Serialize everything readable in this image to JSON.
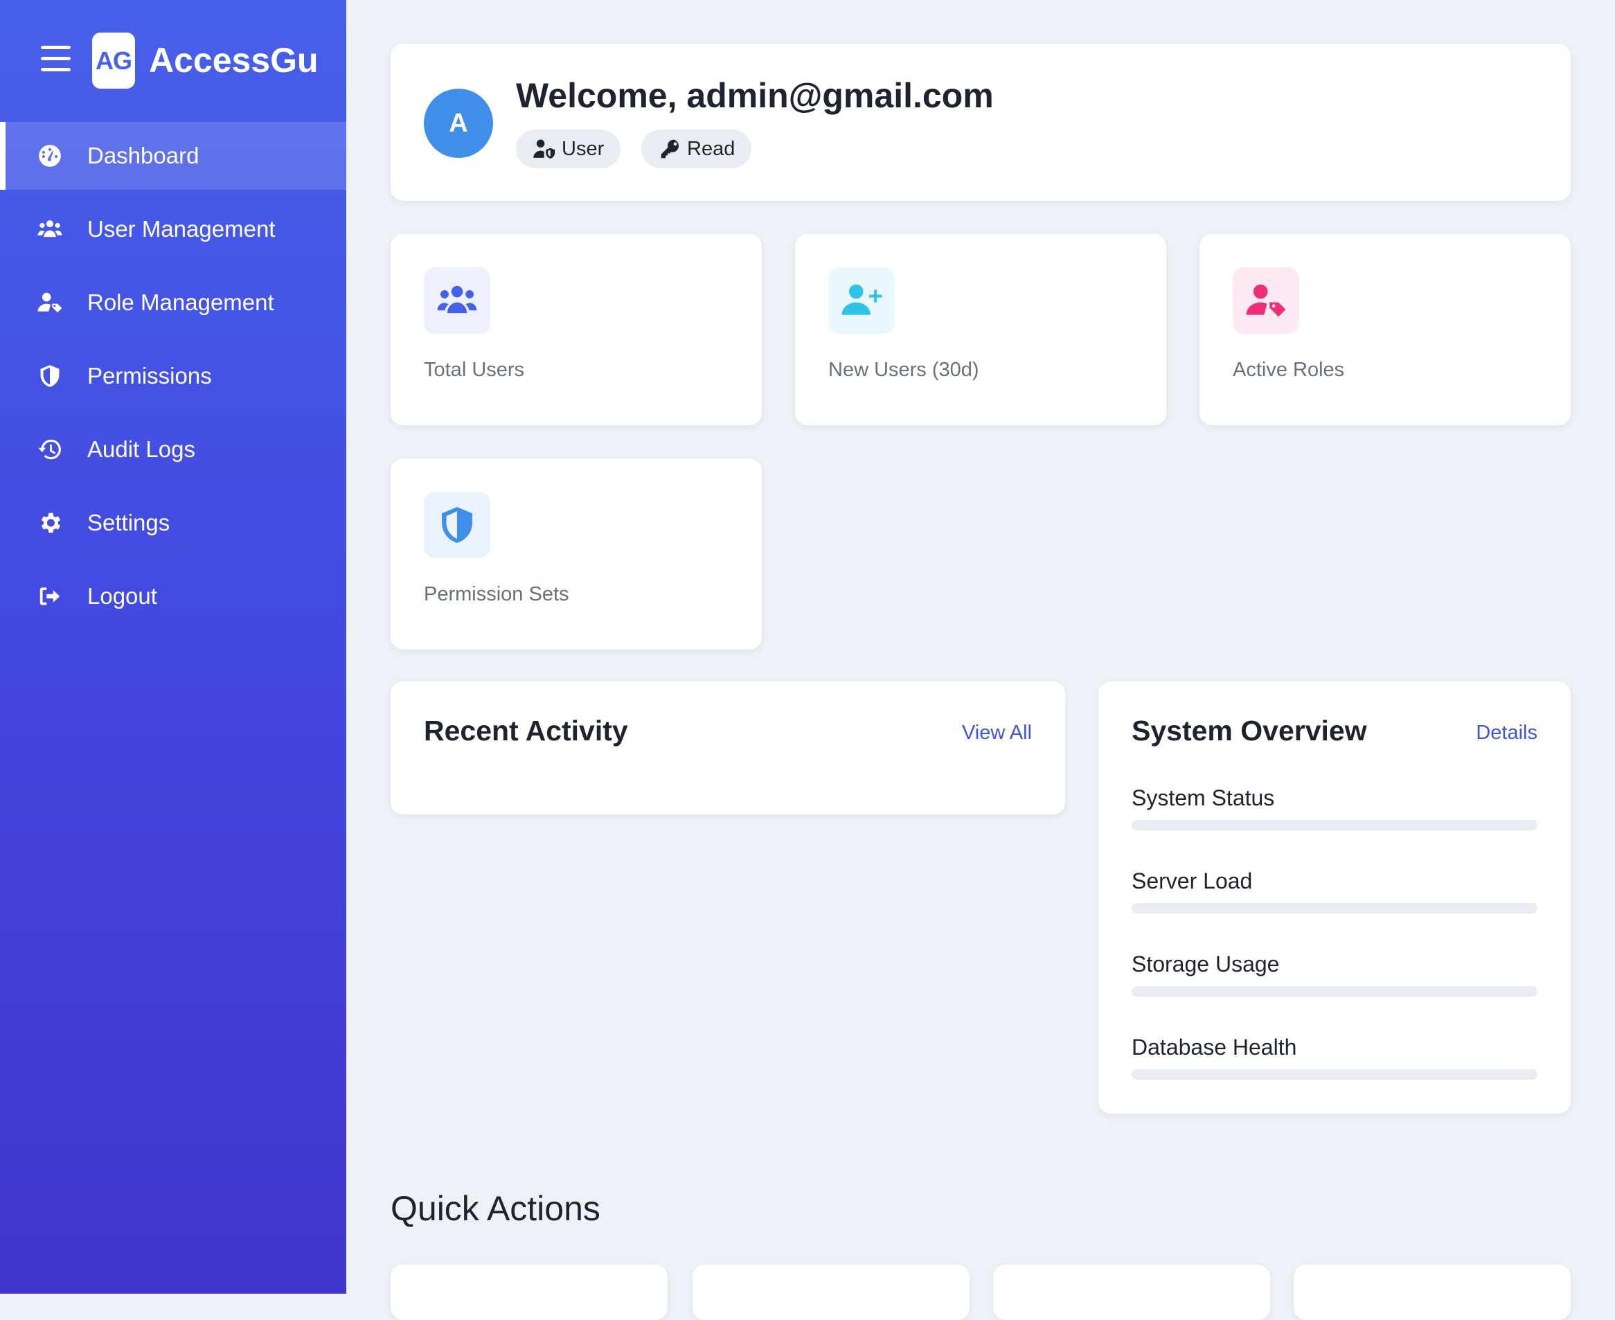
{
  "app": {
    "brand_initials": "AG",
    "brand_name": "AccessGu"
  },
  "sidebar": {
    "items": [
      {
        "label": "Dashboard",
        "icon": "dashboard-gauge-icon",
        "active": true
      },
      {
        "label": "User Management",
        "icon": "users-group-icon"
      },
      {
        "label": "Role Management",
        "icon": "user-tag-icon"
      },
      {
        "label": "Permissions",
        "icon": "shield-icon"
      },
      {
        "label": "Audit Logs",
        "icon": "history-icon"
      },
      {
        "label": "Settings",
        "icon": "gear-icon"
      },
      {
        "label": "Logout",
        "icon": "sign-out-icon"
      }
    ]
  },
  "welcome": {
    "avatar_initial": "A",
    "title": "Welcome, admin@gmail.com",
    "role_chip": "User",
    "role_chip_icon": "user-shield-icon",
    "permission_chip": "Read",
    "permission_chip_icon": "key-icon"
  },
  "stats": [
    {
      "label": "Total Users",
      "icon": "users-group-icon",
      "color": "#4660ea",
      "bg": "#eef1fd"
    },
    {
      "label": "New Users (30d)",
      "icon": "user-plus-icon",
      "color": "#2ec4ea",
      "bg": "#eaf7fc"
    },
    {
      "label": "Active Roles",
      "icon": "user-tag-icon",
      "color": "#ee2f78",
      "bg": "#fde9f1"
    },
    {
      "label": "Permission Sets",
      "icon": "shield-halved-icon",
      "color": "#3f8ee9",
      "bg": "#eaf3fd"
    }
  ],
  "recent_activity": {
    "title": "Recent Activity",
    "link": "View All"
  },
  "system_overview": {
    "title": "System Overview",
    "link": "Details",
    "metrics": [
      {
        "label": "System Status",
        "value": 0
      },
      {
        "label": "Server Load",
        "value": 0
      },
      {
        "label": "Storage Usage",
        "value": 0
      },
      {
        "label": "Database Health",
        "value": 0
      }
    ]
  },
  "quick_actions": {
    "title": "Quick Actions"
  },
  "colors": {
    "sidebar_top": "#4660ea",
    "sidebar_bottom": "#3f35cc",
    "accent": "#3e56d6",
    "page_bg": "#eef2f7"
  }
}
